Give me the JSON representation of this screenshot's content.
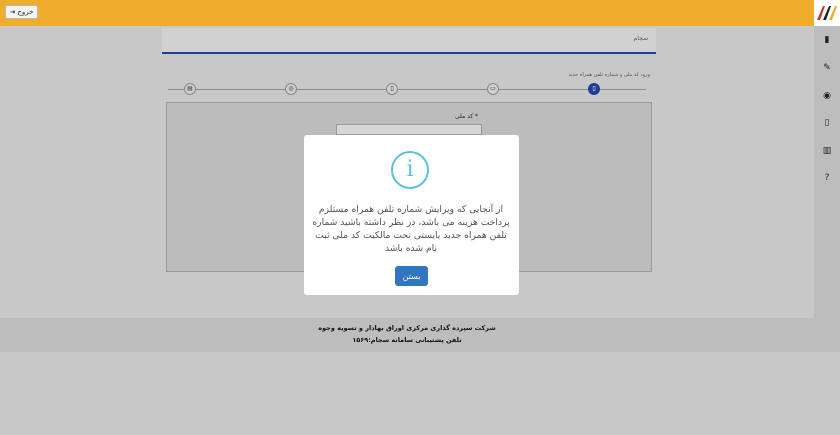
{
  "header": {
    "exit_label": "خروج",
    "exit_icon": "sign-out-icon",
    "accent_color": "#f0ad2c"
  },
  "sidebar": {
    "items": [
      {
        "icon": "book-icon",
        "glyph": "▮"
      },
      {
        "icon": "edit-icon",
        "glyph": "✎"
      },
      {
        "icon": "eye-icon",
        "glyph": "◉"
      },
      {
        "icon": "mobile-icon",
        "glyph": "▯"
      },
      {
        "icon": "building-icon",
        "glyph": "▥"
      },
      {
        "icon": "question-icon",
        "glyph": "?"
      }
    ]
  },
  "breadcrumb": {
    "text": "سجام"
  },
  "wizard": {
    "hint": "ورود کد ملی و شماره تلفن همراه جدید",
    "steps": [
      {
        "icon": "mobile-icon",
        "glyph": "▯",
        "active": true
      },
      {
        "icon": "id-card-icon",
        "glyph": "▭",
        "active": false
      },
      {
        "icon": "mobile-outline-icon",
        "glyph": "▯",
        "active": false
      },
      {
        "icon": "lock-icon",
        "glyph": "◎",
        "active": false
      },
      {
        "icon": "document-icon",
        "glyph": "▤",
        "active": false
      }
    ],
    "field_label": "کد ملی",
    "required_mark": "*",
    "field_value": ""
  },
  "modal": {
    "icon": "info-icon",
    "icon_glyph": "i",
    "message": "از آنجایی که ویرایش شماره تلفن همراه مستلزم پرداخت هزینه می باشد، در نظر داشته باشید شماره تلفن همراه جدید بایستی تحت مالکیت کد ملی ثبت نام شده باشد",
    "close_label": "بستن",
    "button_color": "#3176bf",
    "icon_color": "#5bc2d6"
  },
  "footer": {
    "line1": "شرکت سپرده گذاری مرکزی اوراق بهادار و تسویه وجوه",
    "line2": "تلفن پشتیبانی سامانه سجام:۱۵۶۹"
  }
}
